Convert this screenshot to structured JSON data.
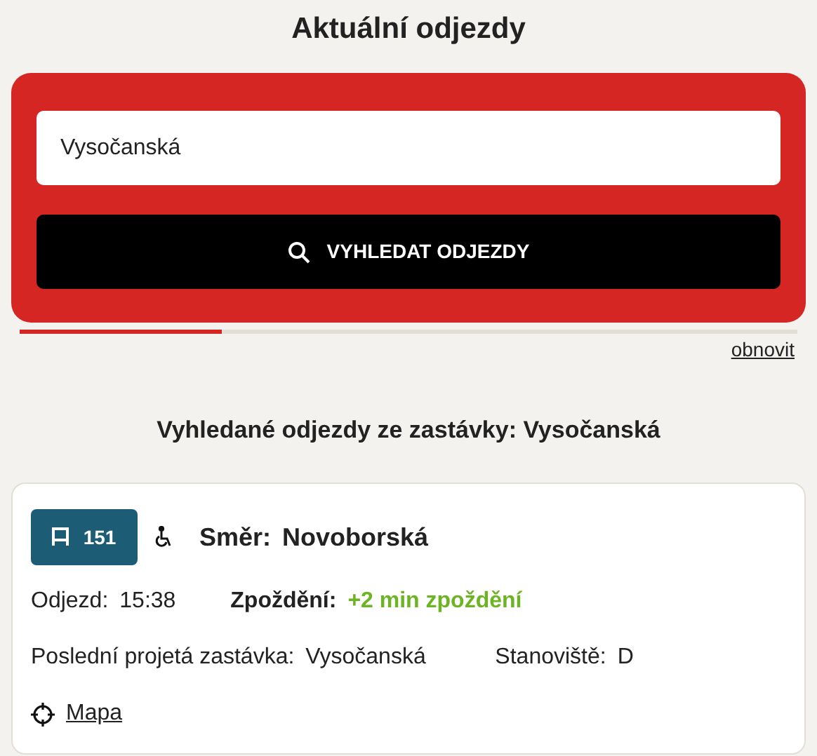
{
  "page_title": "Aktuální odjezdy",
  "search": {
    "value": "Vysočanská",
    "button": "VYHLEDAT ODJEZDY"
  },
  "progress": {
    "level": 0.26
  },
  "refresh_link": "obnovit",
  "results_heading": "Vyhledané odjezdy ze zastávky: Vysočanská",
  "departures": [
    {
      "line": "151",
      "accessible": true,
      "direction_label": "Směr:",
      "direction": "Novoborská",
      "departure_label": "Odjezd:",
      "departure": "15:38",
      "delay_label": "Zpoždění:",
      "delay": "+2 min zpoždění",
      "last_stop_label": "Poslední projetá zastávka:",
      "last_stop": "Vysočanská",
      "platform_label": "Stanoviště:",
      "platform": "D",
      "map_link": "Mapa"
    }
  ]
}
